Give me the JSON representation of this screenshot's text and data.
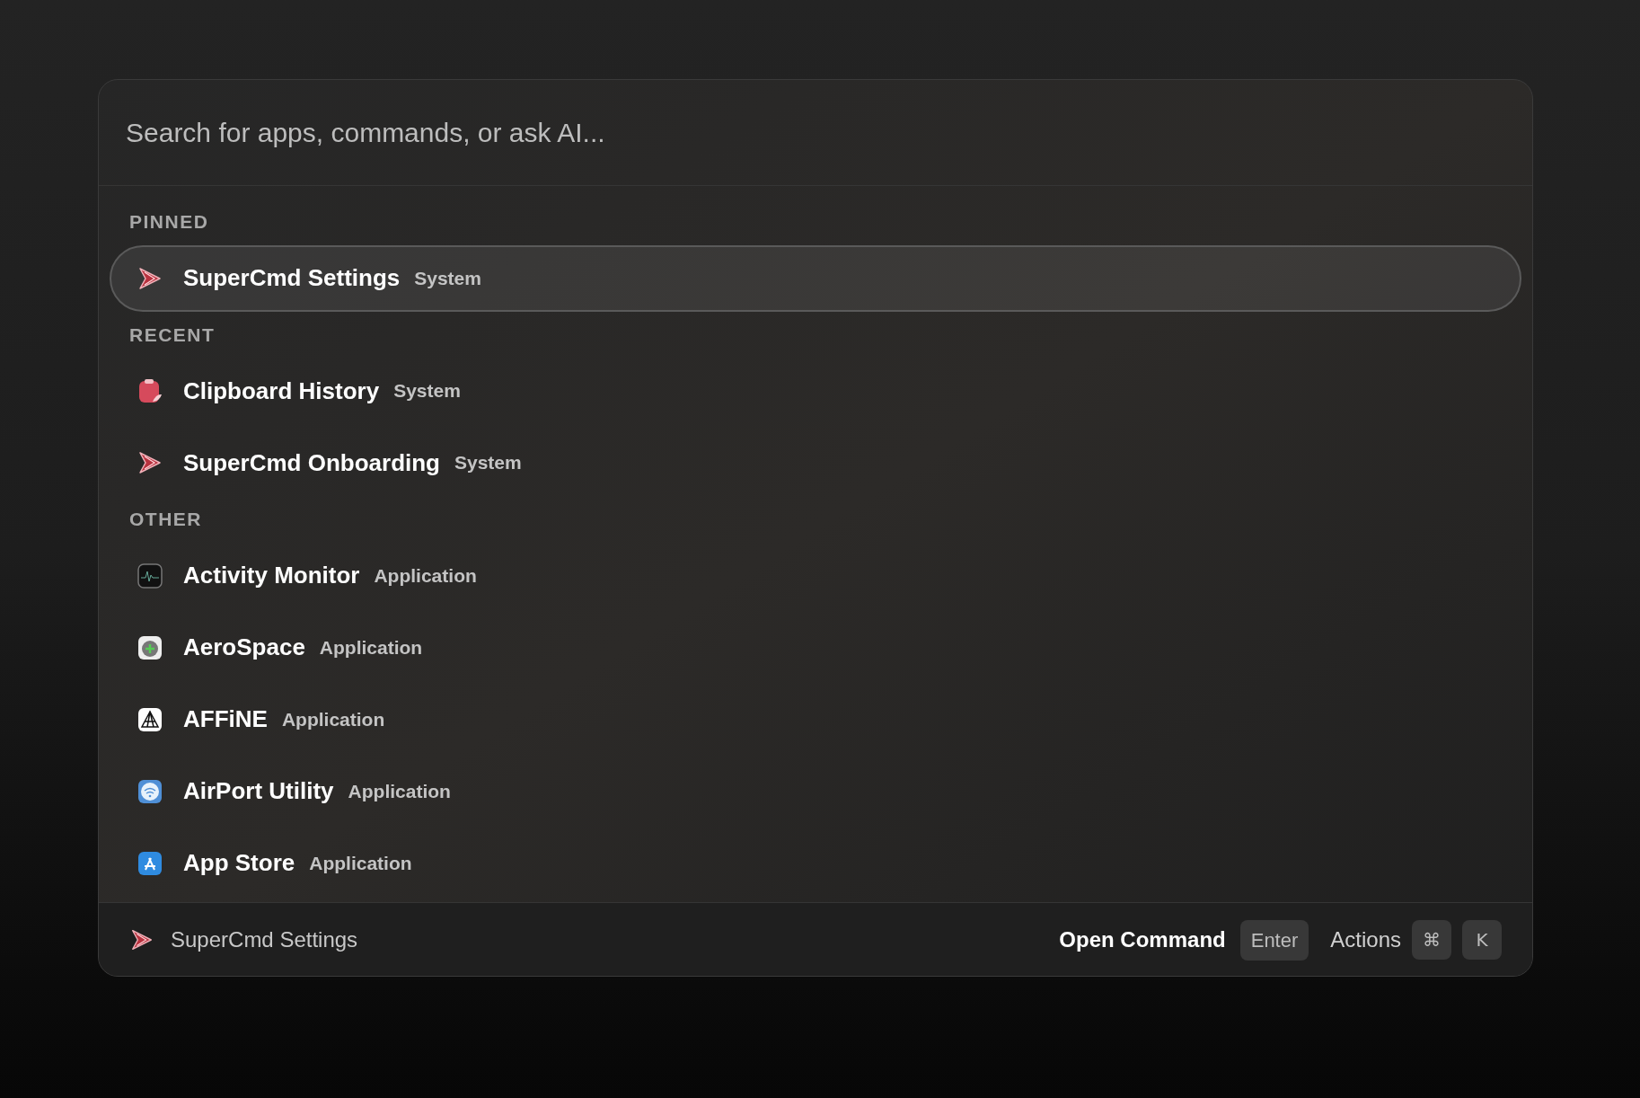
{
  "search": {
    "placeholder": "Search for apps, commands, or ask AI..."
  },
  "sections": [
    {
      "title": "PINNED",
      "items": [
        {
          "kind": "supercmd",
          "name": "SuperCmd Settings",
          "type": "System",
          "selected": true
        }
      ]
    },
    {
      "title": "RECENT",
      "items": [
        {
          "kind": "clipboard",
          "name": "Clipboard History",
          "type": "System",
          "selected": false
        },
        {
          "kind": "supercmd",
          "name": "SuperCmd Onboarding",
          "type": "System",
          "selected": false
        }
      ]
    },
    {
      "title": "OTHER",
      "items": [
        {
          "kind": "activity",
          "name": "Activity Monitor",
          "type": "Application",
          "selected": false
        },
        {
          "kind": "aerospace",
          "name": "AeroSpace",
          "type": "Application",
          "selected": false
        },
        {
          "kind": "affine",
          "name": "AFFiNE",
          "type": "Application",
          "selected": false
        },
        {
          "kind": "airport",
          "name": "AirPort Utility",
          "type": "Application",
          "selected": false
        },
        {
          "kind": "appstore",
          "name": "App Store",
          "type": "Application",
          "selected": false
        }
      ]
    }
  ],
  "footer": {
    "current": "SuperCmd Settings",
    "primary": "Open Command",
    "primary_key": "Enter",
    "secondary": "Actions",
    "secondary_keys": [
      "⌘",
      "K"
    ]
  }
}
